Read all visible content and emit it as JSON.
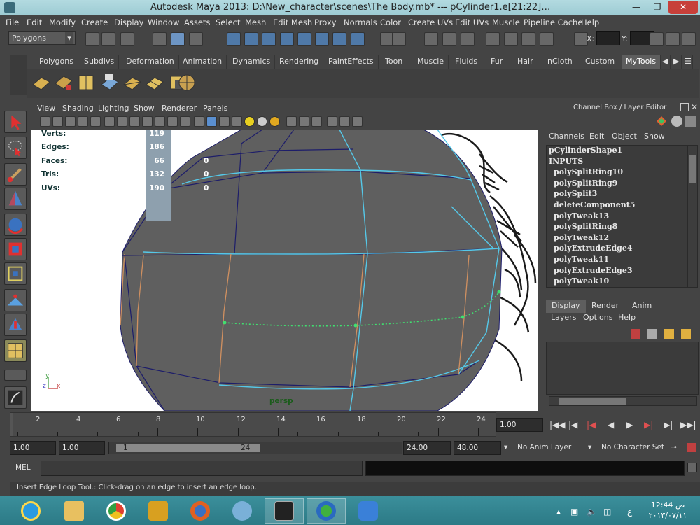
{
  "window": {
    "title": "Autodesk Maya 2013: D:\\New_character\\scenes\\The Body.mb*   ---    pCylinder1.e[21:22]…"
  },
  "menubar": [
    "File",
    "Edit",
    "Modify",
    "Create",
    "Display",
    "Window",
    "Assets",
    "Select",
    "Mesh",
    "Edit Mesh",
    "Proxy",
    "Normals",
    "Color",
    "Create UVs",
    "Edit UVs",
    "Muscle",
    "Pipeline Cache",
    "Help"
  ],
  "statusline": {
    "mode": "Polygons",
    "x_label": "X:",
    "y_label": "Y:"
  },
  "shelf_tabs": [
    "Polygons",
    "Subdivs",
    "Deformation",
    "Animation",
    "Dynamics",
    "Rendering",
    "PaintEffects",
    "Toon",
    "Muscle",
    "Fluids",
    "Fur",
    "Hair",
    "nCloth",
    "Custom",
    "MyTools"
  ],
  "shelf_active_tab": "MyTools",
  "viewport": {
    "menu": [
      "View",
      "Shading",
      "Lighting",
      "Show",
      "Renderer",
      "Panels"
    ],
    "hud": [
      {
        "label": "Verts:",
        "value": "119",
        "selected": ""
      },
      {
        "label": "Edges:",
        "value": "186",
        "selected": "0"
      },
      {
        "label": "Faces:",
        "value": "66",
        "selected": "0"
      },
      {
        "label": "Tris:",
        "value": "132",
        "selected": "0"
      },
      {
        "label": "UVs:",
        "value": "190",
        "selected": "0"
      }
    ],
    "camera_label": "persp",
    "axis": {
      "y": "y",
      "z": "z",
      "x": "x"
    }
  },
  "channel_box": {
    "title": "Channel Box / Layer Editor",
    "menu": [
      "Channels",
      "Edit",
      "Object",
      "Show"
    ],
    "shape_name": "pCylinderShape1",
    "inputs_label": "INPUTS",
    "history": [
      "polySplitRing10",
      "polySplitRing9",
      "polySplit3",
      "deleteComponent5",
      "polyTweak13",
      "polySplitRing8",
      "polyTweak12",
      "polyExtrudeEdge4",
      "polyTweak11",
      "polyExtrudeEdge3",
      "polyTweak10"
    ]
  },
  "layer_editor": {
    "tabs": [
      "Display",
      "Render",
      "Anim"
    ],
    "menu": [
      "Layers",
      "Options",
      "Help"
    ]
  },
  "timeline": {
    "ticks": [
      "2",
      "4",
      "6",
      "8",
      "10",
      "12",
      "14",
      "16",
      "18",
      "20",
      "22",
      "24"
    ],
    "current_frame": "1.00"
  },
  "range": {
    "start": "1.00",
    "playback_start": "1.00",
    "slider_start": "1",
    "slider_end": "24",
    "playback_end": "24.00",
    "end": "48.00",
    "anim_layer": "No Anim Layer",
    "character_set": "No Character Set"
  },
  "command_line": {
    "label": "MEL"
  },
  "help_line": "Insert Edge Loop Tool.: Click-drag on an edge to insert an edge loop.",
  "taskbar": {
    "time": "12:44 ص",
    "date": "٢٠١٣/٠٧/١١",
    "lang": "ع"
  }
}
